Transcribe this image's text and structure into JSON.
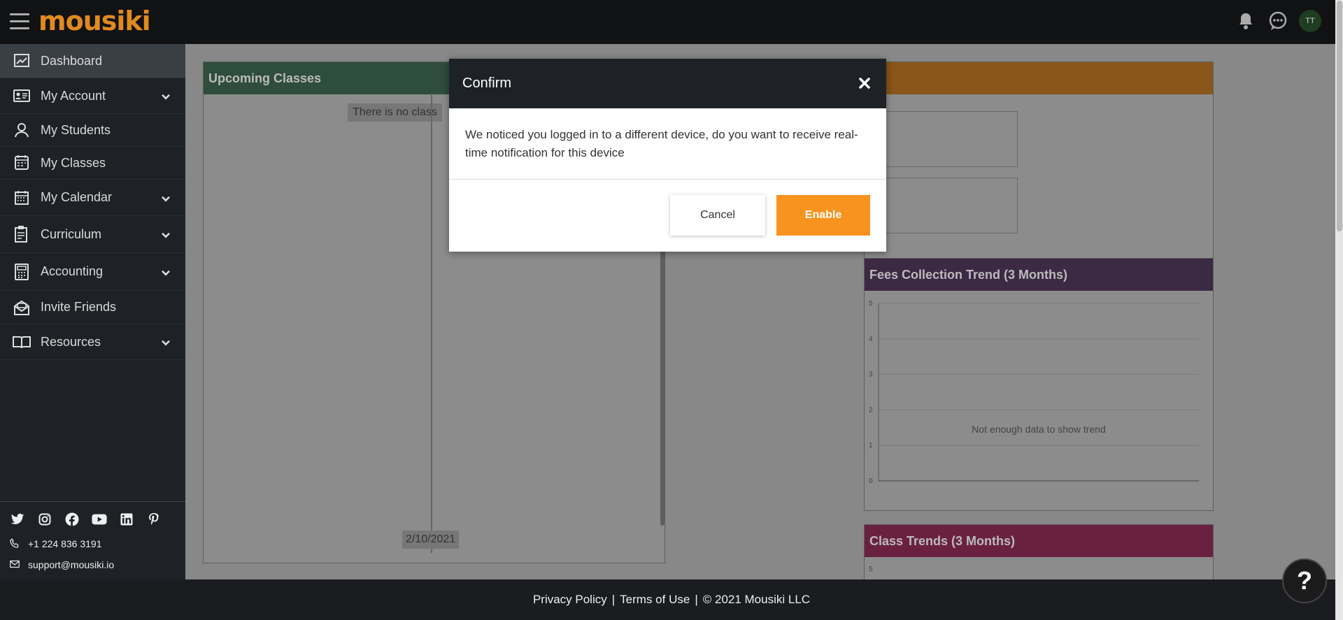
{
  "app": {
    "logo_text": "mousiki"
  },
  "header": {
    "avatar_initials": "TT"
  },
  "sidebar": {
    "items": [
      {
        "label": "Dashboard",
        "icon": "chart-icon",
        "has_chevron": false,
        "active": true
      },
      {
        "label": "My Account",
        "icon": "id-card-icon",
        "has_chevron": true
      },
      {
        "label": "My Students",
        "icon": "user-icon",
        "has_chevron": false
      },
      {
        "label": "My Classes",
        "icon": "calendar-classes-icon",
        "has_chevron": false
      },
      {
        "label": "My Calendar",
        "icon": "calendar-icon",
        "has_chevron": true
      },
      {
        "label": "Curriculum",
        "icon": "clipboard-icon",
        "has_chevron": true
      },
      {
        "label": "Accounting",
        "icon": "calculator-icon",
        "has_chevron": true
      },
      {
        "label": "Invite Friends",
        "icon": "envelope-open-icon",
        "has_chevron": false
      },
      {
        "label": "Resources",
        "icon": "book-icon",
        "has_chevron": true
      }
    ],
    "phone": "+1 224 836 3191",
    "email": "support@mousiki.io"
  },
  "main": {
    "upcoming_title": "Upcoming Classes",
    "no_class_text": "There is no class",
    "date_label": "2/10/2021",
    "fees_title": "Fees Collection Trend (3 Months)",
    "fees_message": "Not enough data to show trend",
    "class_trends_title": "Class Trends (3 Months)"
  },
  "chart_data": [
    {
      "type": "line",
      "title": "Fees Collection Trend (3 Months)",
      "yticks": [
        5,
        4,
        3,
        2,
        1,
        0
      ],
      "ylim": [
        0,
        5
      ],
      "series": [],
      "annotation": "Not enough data to show trend",
      "grid": true
    },
    {
      "type": "line",
      "title": "Class Trends (3 Months)",
      "yticks": [
        5
      ],
      "series": []
    }
  ],
  "footer": {
    "privacy": "Privacy Policy",
    "sep1": "|",
    "terms": "Terms of Use",
    "sep2": "|",
    "copyright": "© 2021 Mousiki LLC"
  },
  "modal": {
    "title": "Confirm",
    "message": "We noticed you logged in to a different device, do you want to receive real-time notification for this device",
    "cancel_label": "Cancel",
    "enable_label": "Enable"
  },
  "help": {
    "label": "?"
  },
  "colors": {
    "accent": "#f7931e",
    "topbar": "#111214",
    "sidebar": "#1e2227"
  }
}
